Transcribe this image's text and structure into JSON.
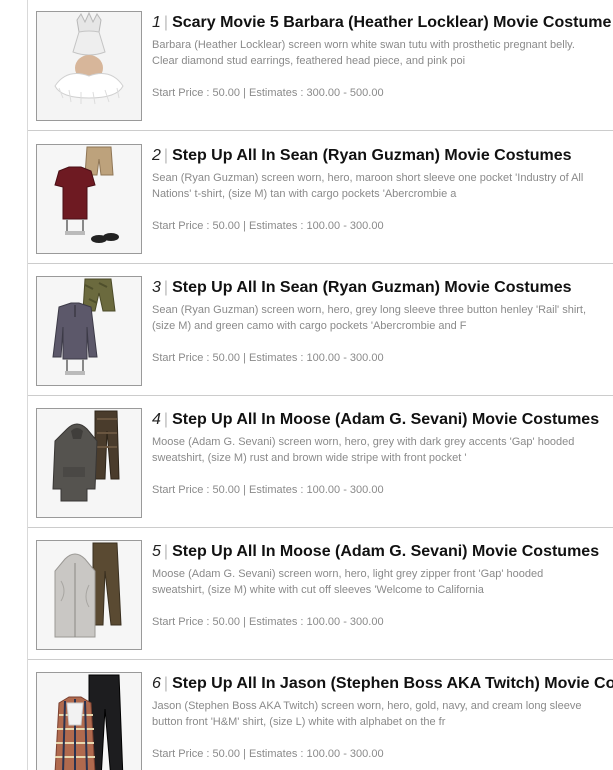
{
  "lots": [
    {
      "number": "1",
      "title": "Scary Movie 5 Barbara (Heather Locklear) Movie Costume",
      "description": "Barbara (Heather Locklear) screen worn white swan tutu with prosthetic pregnant belly. Clear diamond stud earrings, feathered head piece, and pink poi",
      "start_price_label": "Start Price : 50.00",
      "estimates_label": "Estimates : 300.00 - 500.00",
      "thumb_icon": "tutu-costume-icon"
    },
    {
      "number": "2",
      "title": "Step Up All In Sean (Ryan Guzman) Movie Costumes",
      "description": "Sean (Ryan Guzman) screen worn, hero, maroon short sleeve one pocket 'Industry of All Nations' t-shirt, (size M) tan with cargo pockets 'Abercrombie a",
      "start_price_label": "Start Price : 50.00",
      "estimates_label": "Estimates : 100.00 - 300.00",
      "thumb_icon": "tshirt-shorts-icon"
    },
    {
      "number": "3",
      "title": "Step Up All In Sean (Ryan Guzman) Movie Costumes",
      "description": "Sean (Ryan Guzman) screen worn, hero, grey long sleeve three button henley 'Rail' shirt, (size M) and green camo with cargo pockets 'Abercrombie and F",
      "start_price_label": "Start Price : 50.00",
      "estimates_label": "Estimates : 100.00 - 300.00",
      "thumb_icon": "henley-shorts-icon"
    },
    {
      "number": "4",
      "title": "Step Up All In Moose (Adam G. Sevani) Movie Costumes",
      "description": "Moose (Adam G. Sevani) screen worn, hero, grey with dark grey accents 'Gap' hooded sweatshirt, (size M) rust and brown wide stripe with front pocket '",
      "start_price_label": "Start Price : 50.00",
      "estimates_label": "Estimates : 100.00 - 300.00",
      "thumb_icon": "hoodie-pants-icon"
    },
    {
      "number": "5",
      "title": "Step Up All In Moose (Adam G. Sevani) Movie Costumes",
      "description": "Moose (Adam G. Sevani) screen worn, hero, light grey zipper front 'Gap' hooded sweatshirt, (size M) white with cut off sleeves 'Welcome to California",
      "start_price_label": "Start Price : 50.00",
      "estimates_label": "Estimates : 100.00 - 300.00",
      "thumb_icon": "zip-hoodie-pants-icon"
    },
    {
      "number": "6",
      "title": "Step Up All In Jason (Stephen Boss AKA Twitch) Movie Co",
      "description": "Jason (Stephen Boss AKA Twitch) screen worn, hero, gold, navy, and cream long sleeve button front 'H&M' shirt, (size L) white with alphabet on the fr",
      "start_price_label": "Start Price : 50.00",
      "estimates_label": "Estimates : 100.00 - 300.00",
      "thumb_icon": "plaid-shirt-pants-icon"
    }
  ],
  "price_separator": "|",
  "title_separator": "|"
}
